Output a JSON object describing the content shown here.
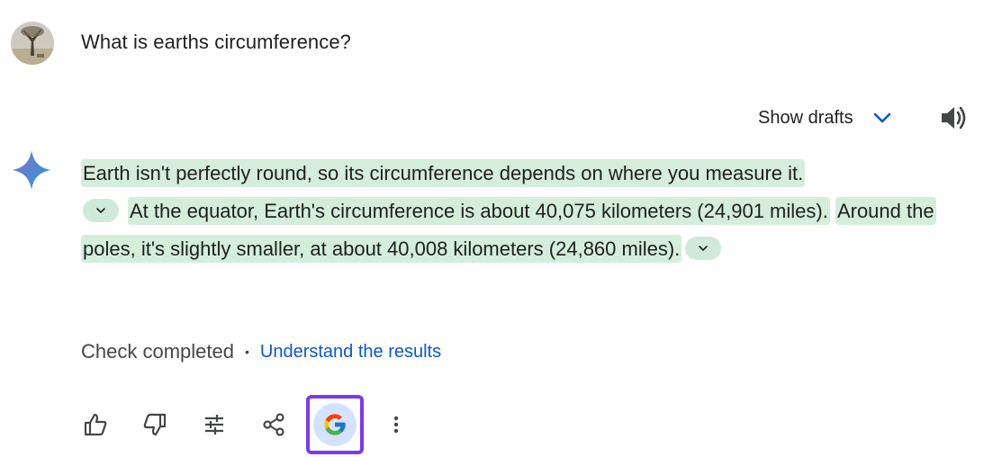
{
  "prompt": {
    "text": "What is earths circumference?",
    "avatar_icon": "user-photo-avatar"
  },
  "drafts": {
    "label": "Show drafts",
    "icon": "chevron-down-icon"
  },
  "speaker_icon": "volume-icon",
  "response": {
    "logo_icon": "gemini-sparkle-icon",
    "highlight_color": "#d4eedb",
    "sentence1": "Earth isn't perfectly round, so its circumference depends on where you measure it.",
    "sentence2": "At the equator, Earth's circumference is about 40,075 kilometers (24,901 miles).",
    "sentence3": "Around the poles, it's slightly smaller, at about 40,008 kilometers (24,860 miles)."
  },
  "check": {
    "status": "Check completed",
    "separator": "•",
    "link": "Understand the results",
    "link_color": "#0b57d0"
  },
  "actions": [
    {
      "name": "thumbs-up-icon"
    },
    {
      "name": "thumbs-down-icon"
    },
    {
      "name": "tune-icon"
    },
    {
      "name": "share-icon"
    },
    {
      "name": "google-g-icon",
      "highlight": "#7c3aed"
    },
    {
      "name": "more-vert-icon"
    }
  ]
}
